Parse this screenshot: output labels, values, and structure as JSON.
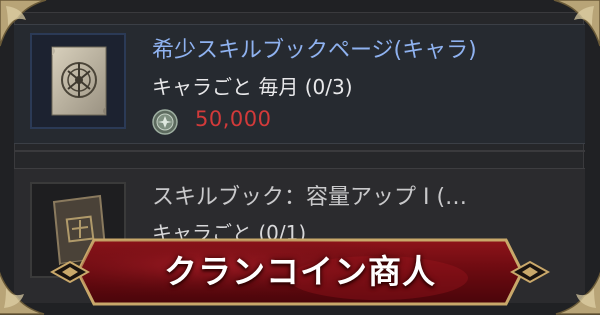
{
  "items": [
    {
      "title": "希少スキルブックページ(キャラ)",
      "limit": "キャラごと 毎月 (0/3)",
      "price": "50,000",
      "icon": "scroll-page-icon"
    },
    {
      "title": "スキルブック：容量アップ I (…",
      "limit": "キャラごと (0/1)",
      "icon": "skill-book-icon"
    }
  ],
  "currency_icon": "clan-coin-icon",
  "banner": {
    "title": "クランコイン商人"
  },
  "colors": {
    "title_blue": "#8fb2f0",
    "price_red": "#d23a3a",
    "banner_red": "#7a0d12",
    "gold": "#c9a86a"
  }
}
